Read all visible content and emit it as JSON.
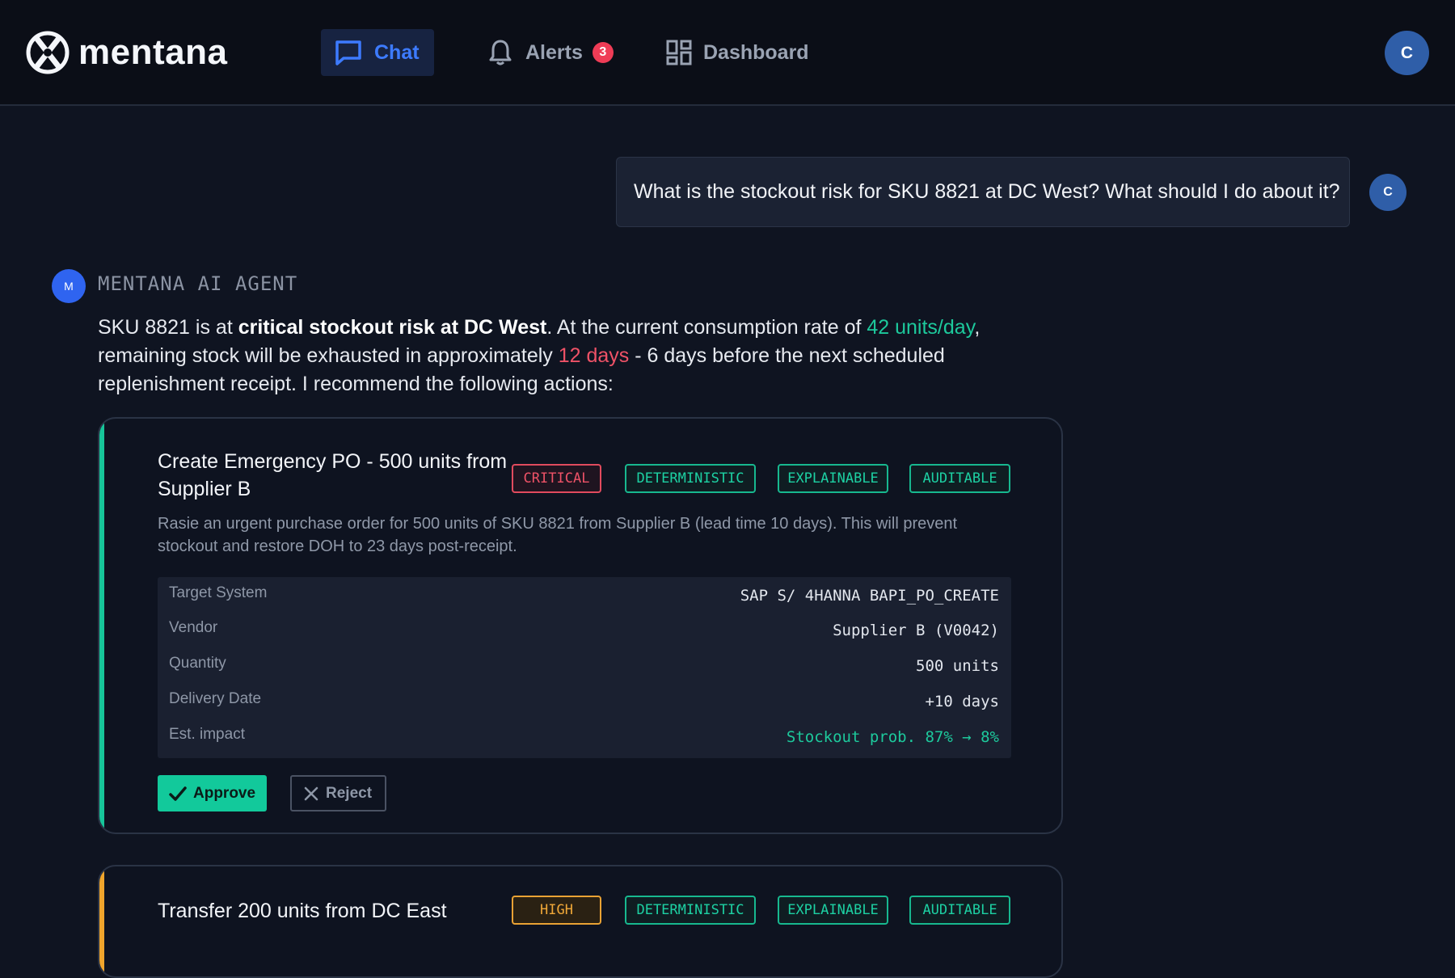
{
  "brand": {
    "name": "mentana"
  },
  "nav": {
    "chat": "Chat",
    "alerts": "Alerts",
    "alerts_count": "3",
    "dashboard": "Dashboard"
  },
  "user": {
    "initial": "C"
  },
  "conversation": {
    "user_message": "What is the stockout risk for SKU 8821 at DC West? What should I do about it?",
    "user_initial": "C",
    "agent_initial": "M",
    "agent_name": "MENTANA AI AGENT",
    "agent_reply": {
      "p1": "SKU 8821 is at ",
      "p1_bold": "critical stockout risk at DC West",
      "p2": ". At the current consumption rate of ",
      "rate": "42 units/day",
      "p3": ", remaining stock will be exhausted in approximately ",
      "days": "12 days",
      "p4": " - 6 days before the next scheduled replenishment receipt. I recommend the following actions:"
    }
  },
  "actions": [
    {
      "title": "Create Emergency PO - 500 units from Supplier B",
      "priority": "CRITICAL",
      "tags": [
        "DETERMINISTIC",
        "EXPLAINABLE",
        "AUDITABLE"
      ],
      "description": "Rasie an urgent purchase order for 500 units of SKU 8821 from Supplier B (lead time 10 days). This will prevent stockout and restore DOH to 23 days post-receipt.",
      "details": [
        {
          "label": "Target System",
          "value": "SAP S/ 4HANNA BAPI_PO_CREATE"
        },
        {
          "label": "Vendor",
          "value": "Supplier B (V0042)"
        },
        {
          "label": "Quantity",
          "value": "500 units"
        },
        {
          "label": "Delivery Date",
          "value": "+10 days"
        },
        {
          "label": "Est. impact",
          "value": "Stockout prob. 87% → 8%"
        }
      ],
      "approve_label": "Approve",
      "reject_label": "Reject"
    },
    {
      "title": "Transfer 200 units from DC East",
      "priority": "HIGH",
      "tags": [
        "DETERMINISTIC",
        "EXPLAINABLE",
        "AUDITABLE"
      ]
    }
  ],
  "colors": {
    "accent_blue": "#3d7bff",
    "critical": "#ef5267",
    "high": "#f0a838",
    "success": "#1dc99c"
  }
}
